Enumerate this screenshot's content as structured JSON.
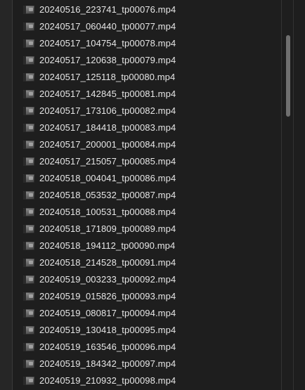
{
  "files": [
    "20240516_223741_tp00076.mp4",
    "20240517_060440_tp00077.mp4",
    "20240517_104754_tp00078.mp4",
    "20240517_120638_tp00079.mp4",
    "20240517_125118_tp00080.mp4",
    "20240517_142845_tp00081.mp4",
    "20240517_173106_tp00082.mp4",
    "20240517_184418_tp00083.mp4",
    "20240517_200001_tp00084.mp4",
    "20240517_215057_tp00085.mp4",
    "20240518_004041_tp00086.mp4",
    "20240518_053532_tp00087.mp4",
    "20240518_100531_tp00088.mp4",
    "20240518_171809_tp00089.mp4",
    "20240518_194112_tp00090.mp4",
    "20240518_214528_tp00091.mp4",
    "20240519_003233_tp00092.mp4",
    "20240519_015826_tp00093.mp4",
    "20240519_080817_tp00094.mp4",
    "20240519_130418_tp00095.mp4",
    "20240519_163546_tp00096.mp4",
    "20240519_184342_tp00097.mp4",
    "20240519_210932_tp00098.mp4"
  ],
  "file_icon": "video-thumbnail-icon",
  "colors": {
    "background": "#1e1e1e",
    "text": "#e6e6e6",
    "scrollbar_thumb": "#6f6f6f"
  }
}
